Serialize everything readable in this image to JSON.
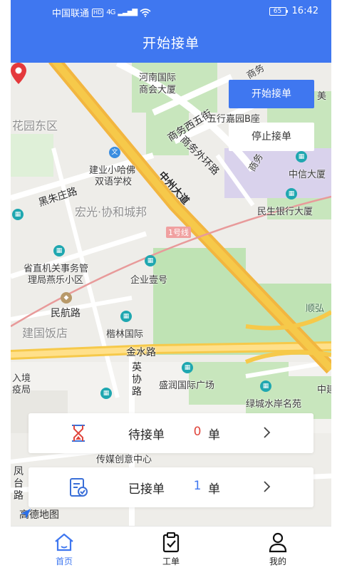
{
  "status_bar": {
    "carrier": "中国联通",
    "hd": "HD",
    "network": "4G",
    "battery": "65",
    "time": "16:42"
  },
  "header": {
    "title": "开始接单"
  },
  "map": {
    "labels": {
      "huayuan_east": "花园东区",
      "henan_chamber": "河南国际",
      "henan_chamber2": "商会大厦",
      "shangwu_west5": "商务西五街",
      "wuhang": "五行嘉园B座",
      "shangwu_outer": "商务外环路",
      "school1": "建业小哈佛",
      "school2": "双语学校",
      "zhongzhou": "中州大道",
      "zhongxin": "中信大厦",
      "heizhu": "黑朱庄路",
      "hongguang": "宏光·协和城邦",
      "minsheng": "民生银行大厦",
      "line1": "1号线",
      "shengzhi1": "省直机关事务管",
      "shengzhi2": "理局燕乐小区",
      "qiye": "企业壹号",
      "minhang": "民航路",
      "jianguo": "建国饭店",
      "shunhong": "顺弘",
      "kailin": "楷林国际",
      "jinshui": "金水路",
      "yingxie": "英协路",
      "shengrun": "盛润国际广场",
      "lvcheng": "绿城水岸名苑",
      "rujing1": "入境",
      "rujing2": "疫局",
      "chuanmei": "传媒创意中心",
      "fengtai": "凤台路",
      "shangwu": "商务",
      "zhongjian": "中建",
      "mei": "美",
      "shang_vert": "商务"
    },
    "amap_logo": "高德地图"
  },
  "buttons": {
    "start": "开始接单",
    "stop": "停止接单"
  },
  "orders": {
    "pending": {
      "label": "待接单",
      "count": "0",
      "unit": "单"
    },
    "accepted": {
      "label": "已接单",
      "count": "1",
      "unit": "单"
    }
  },
  "tabs": [
    {
      "label": "首页",
      "icon": "home-icon",
      "active": true
    },
    {
      "label": "工单",
      "icon": "clipboard-icon",
      "active": false
    },
    {
      "label": "我的",
      "icon": "user-icon",
      "active": false
    }
  ],
  "colors": {
    "primary": "#3f77f0",
    "pending_count": "#e0463d",
    "road_yellow": "#f6c94a",
    "park_green": "#bfe3b4"
  }
}
